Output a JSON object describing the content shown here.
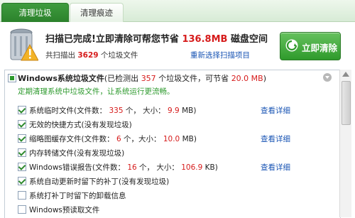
{
  "tabs": [
    {
      "label": "清理垃圾",
      "active": true
    },
    {
      "label": "清理痕迹",
      "active": false
    }
  ],
  "summary": {
    "headline_prefix": "扫描已完成!立即清除可帮您节省",
    "headline_amount": "136.8MB",
    "headline_suffix": "磁盘空间",
    "scanned_prefix": "共扫描出",
    "scanned_count": "3629",
    "scanned_suffix": "个垃圾文件",
    "rescan_label": "重新选择扫描项目",
    "clean_button_label": "立即清除"
  },
  "group": {
    "title": "Windows系统垃圾文件",
    "detected_prefix": "(已检测出",
    "detected_count": "357",
    "detected_mid": "个垃圾文件，可节省",
    "detected_size": "20.0 MB",
    "detected_suffix": ")",
    "tip": "定期清理系统中垃圾文件，让系统运行更流畅。"
  },
  "items": [
    {
      "label_a": "系统临时文件(文件数：",
      "count": "335",
      "label_b": "个，  大小：",
      "size": "9.9",
      "unit": "MB)",
      "detail": "查看详细",
      "checked": true
    },
    {
      "label_a": "无效的快捷方式(没有发现垃圾)",
      "checked": true
    },
    {
      "label_a": "缩略图缓存文件(文件数：",
      "count": "6",
      "label_b": "个，大小：",
      "size": "10.0",
      "unit": "MB)",
      "detail": "查看详细",
      "checked": true
    },
    {
      "label_a": "内存转储文件(没有发现垃圾)",
      "checked": true
    },
    {
      "label_a": "Windows错误报告(文件数：",
      "count": "16",
      "label_b": "个，  大小：",
      "size": "106.9",
      "unit": "KB)",
      "detail": "查看详细",
      "checked": true
    },
    {
      "label_a": "系统自动更新时留下的补丁(没有发现垃圾)",
      "checked": true
    },
    {
      "label_a": "系统打补丁时留下的卸载信息",
      "checked": false
    },
    {
      "label_a": "Windows预读取文件",
      "checked": false
    }
  ],
  "colors": {
    "accent_green": "#2e9a2e",
    "highlight_red": "#d61b1b",
    "link_blue": "#1a55b4"
  }
}
